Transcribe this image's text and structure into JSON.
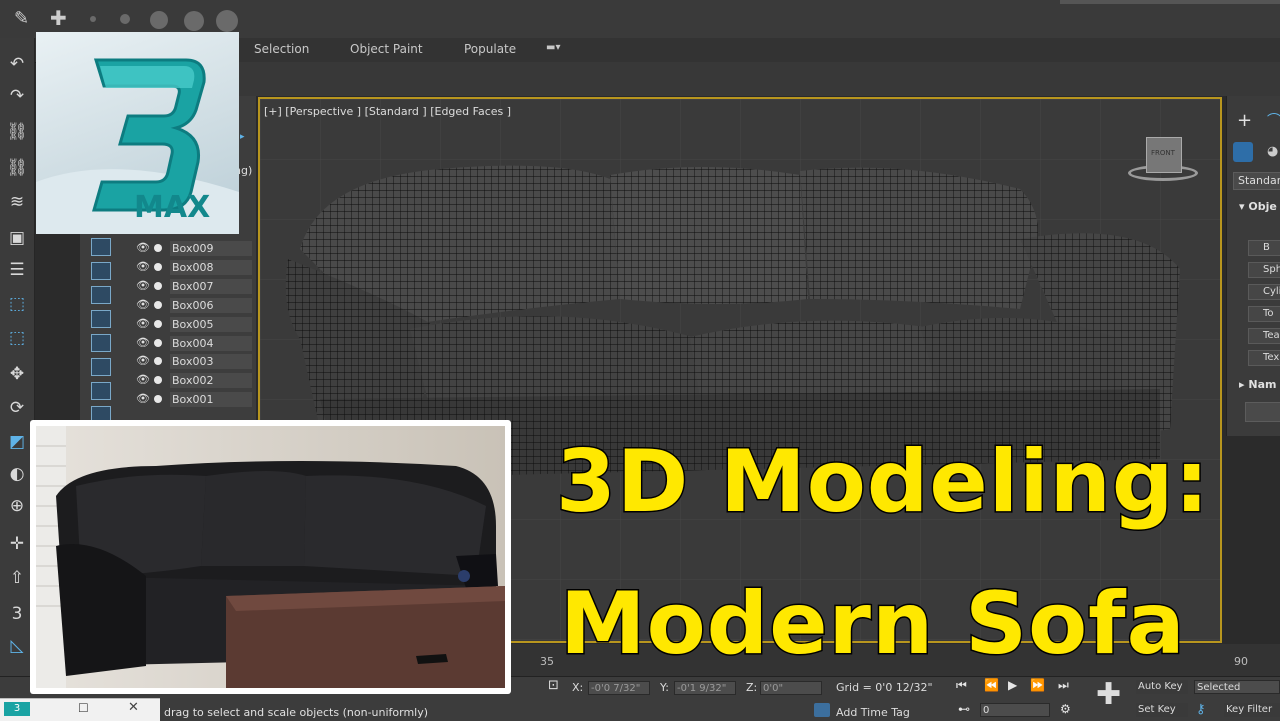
{
  "ribbon": {
    "tabs": [
      "Selection",
      "Object Paint",
      "Populate"
    ]
  },
  "logo": {
    "number": "3",
    "text": "MAX"
  },
  "explorer": {
    "partial_label": "ng)",
    "items": [
      "Box009",
      "Box008",
      "Box007",
      "Box006",
      "Box005",
      "Box004",
      "Box003",
      "Box002",
      "Box001"
    ]
  },
  "viewport": {
    "label": "[+] [Perspective ] [Standard ] [Edged Faces ]",
    "viewcube_label": "FRONT"
  },
  "right_panel": {
    "dropdown": "Standard",
    "section_object_type": "Obje",
    "buttons": [
      "B",
      "Sph",
      "Cyli",
      "To",
      "Tea",
      "Tex"
    ],
    "section_name": "Nam"
  },
  "timeline": {
    "ticks": [
      "35",
      "90"
    ]
  },
  "status": {
    "prompt": "drag to select and scale objects (non-uniformly)",
    "x_label": "X:",
    "x_value": "-0'0 7/32\"",
    "y_label": "Y:",
    "y_value": "-0'1 9/32\"",
    "z_label": "Z:",
    "z_value": "0'0\"",
    "grid": "Grid = 0'0 12/32\"",
    "add_time_tag": "Add Time Tag",
    "frame_value": "0",
    "auto_key": "Auto Key",
    "selected": "Selected",
    "set_key": "Set Key",
    "key_filters": "Key Filter"
  },
  "taskbar": {
    "app_badge": "3"
  },
  "overlay": {
    "line1": "3D Modeling:",
    "line2": "Modern Sofa"
  },
  "colors": {
    "title_yellow": "#ffe800",
    "viewport_border": "#b8961e",
    "logo_teal": "#1aa3a3"
  }
}
